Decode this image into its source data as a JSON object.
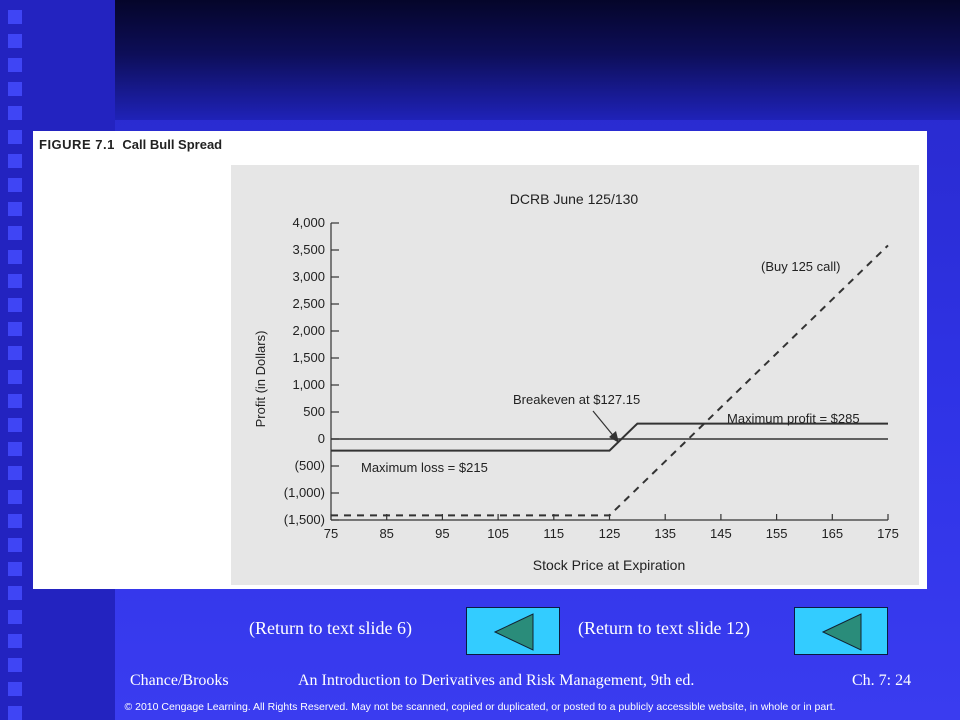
{
  "figure": {
    "label_number": "FIGURE 7.1",
    "label_title": "Call Bull Spread"
  },
  "chart_data": {
    "type": "line",
    "title": "DCRB June 125/130",
    "xlabel": "Stock Price at Expiration",
    "ylabel": "Profit (in Dollars)",
    "xlim": [
      75,
      175
    ],
    "ylim": [
      -1500,
      4000
    ],
    "x_ticks": [
      75,
      85,
      95,
      105,
      115,
      125,
      135,
      145,
      155,
      165,
      175
    ],
    "y_ticks": [
      4000,
      3500,
      3000,
      2500,
      2000,
      1500,
      1000,
      500,
      0,
      -500,
      -1000,
      -1500
    ],
    "y_tick_labels": [
      "4,000",
      "3,500",
      "3,000",
      "2,500",
      "2,000",
      "1,500",
      "1,000",
      "500",
      "0",
      "(500)",
      "(1,000)",
      "(1,500)"
    ],
    "series": [
      {
        "name": "Call Bull Spread",
        "style": "solid",
        "x": [
          75,
          125,
          130,
          175
        ],
        "y": [
          -215,
          -215,
          285,
          285
        ]
      },
      {
        "name": "(Buy 125 call)",
        "style": "dashed",
        "x": [
          75,
          125,
          175
        ],
        "y": [
          -1415,
          -1415,
          3585
        ]
      }
    ],
    "annotations": {
      "breakeven": "Breakeven at $127.15",
      "max_profit": "Maximum profit = $285",
      "max_loss": "Maximum loss = $215",
      "buy_call": "(Buy 125 call)"
    },
    "zero_line": true,
    "grid": false,
    "colors": {
      "line": "#333333",
      "plot_bg": "#e6e6e6"
    }
  },
  "nav": {
    "return1": "(Return to text slide 6)",
    "return2": "(Return to text slide 12)"
  },
  "footer": {
    "authors": "Chance/Brooks",
    "book": "An Introduction to Derivatives and Risk Management, 9th ed.",
    "chapter": "Ch. 7:  24",
    "copyright": "© 2010 Cengage Learning. All Rights Reserved.  May not be scanned, copied or duplicated, or posted to a publicly accessible website, in whole or in part."
  }
}
